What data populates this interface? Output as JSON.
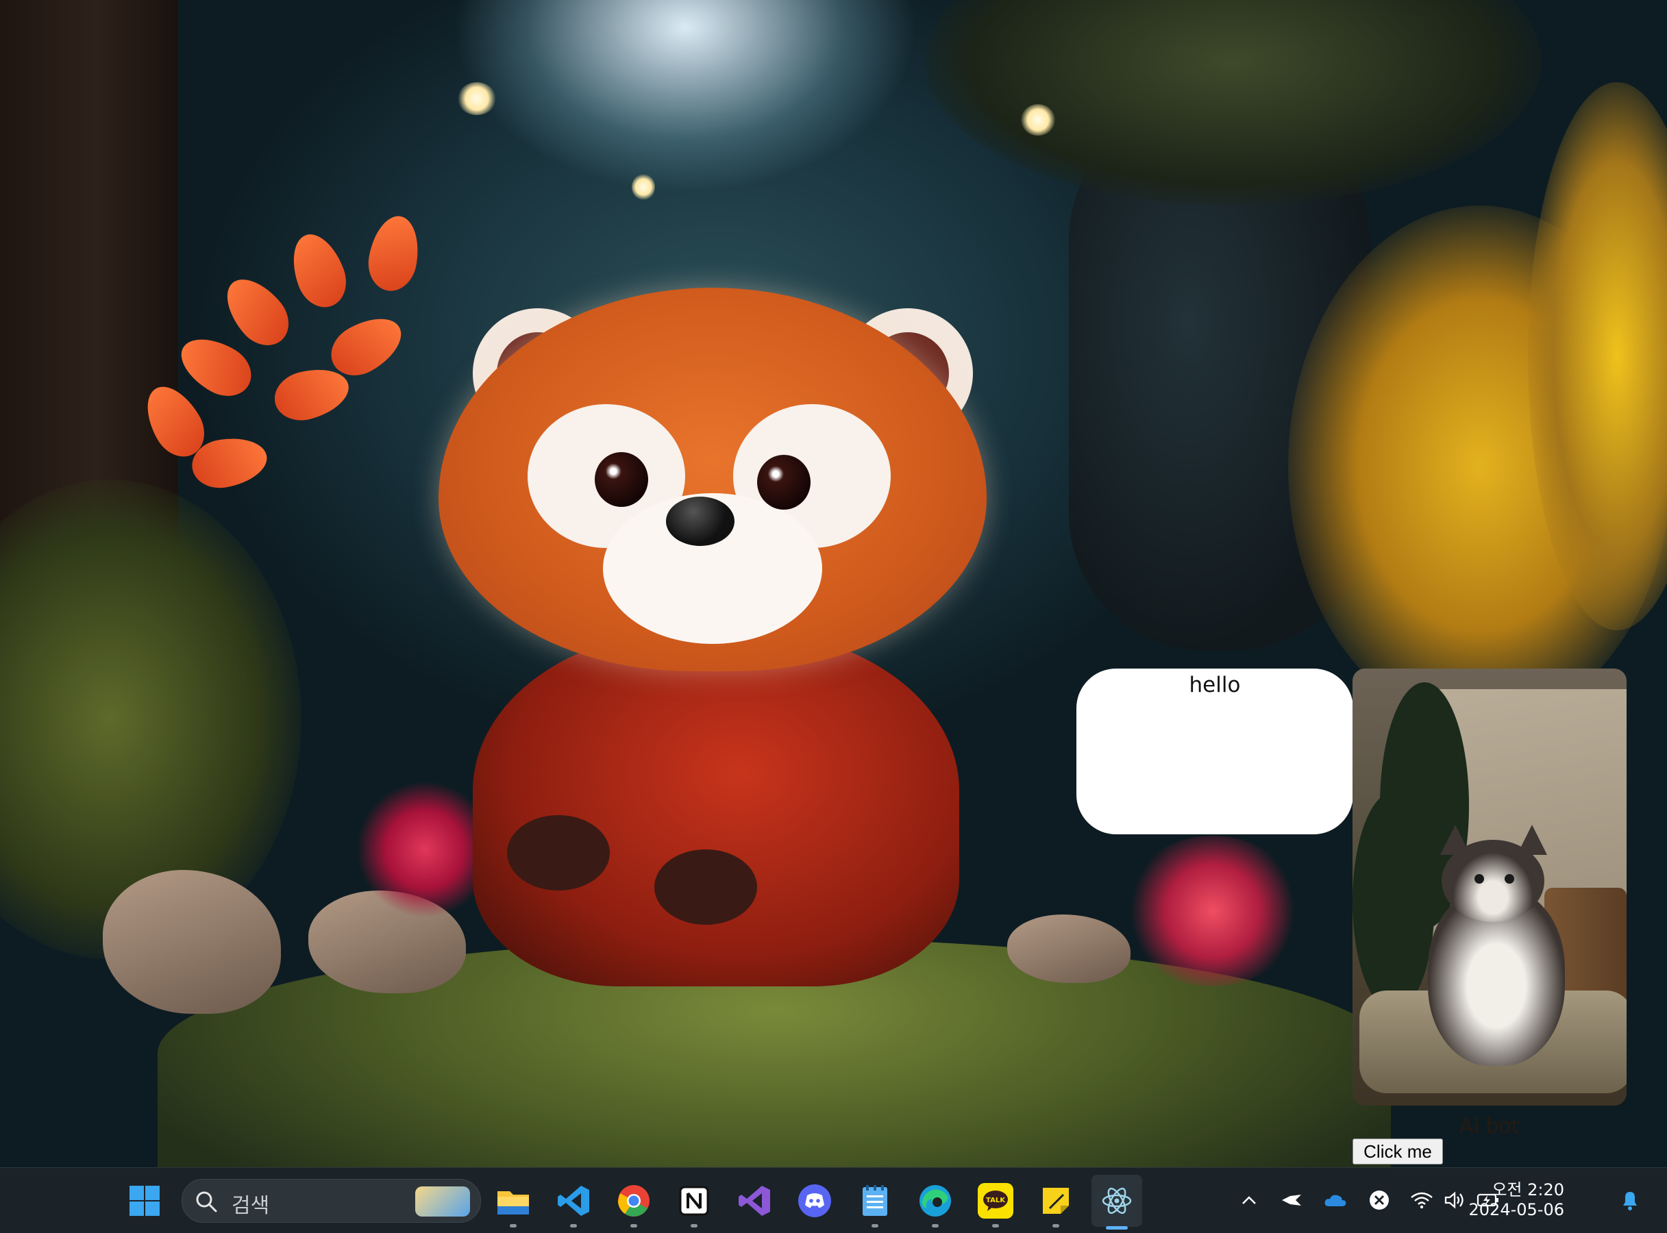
{
  "app": {
    "speech_bubble_text": "hello",
    "bot_label": "Ai bot",
    "button_label": "Click me",
    "photo_icon": "cat-photo-icon"
  },
  "taskbar": {
    "search_placeholder": "검색",
    "pinned": [
      {
        "name": "start-icon"
      },
      {
        "name": "file-explorer-icon"
      },
      {
        "name": "vscode-icon"
      },
      {
        "name": "chrome-icon"
      },
      {
        "name": "notion-icon"
      },
      {
        "name": "visual-studio-icon"
      },
      {
        "name": "discord-icon"
      },
      {
        "name": "notepad-icon"
      },
      {
        "name": "edge-icon"
      },
      {
        "name": "kakaotalk-icon",
        "label": "TALK"
      },
      {
        "name": "sticky-notes-icon"
      },
      {
        "name": "electron-app-icon",
        "active": true
      }
    ],
    "tray": {
      "time": "오전 2:20",
      "date": "2024-05-06"
    },
    "accent_color": "#5fb2ff"
  }
}
